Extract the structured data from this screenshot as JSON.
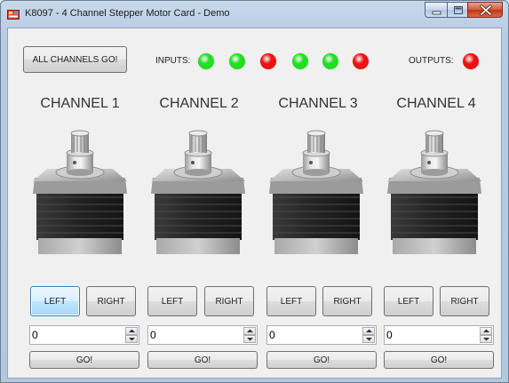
{
  "window": {
    "title": "K8097 - 4 Channel Stepper Motor Card - Demo",
    "icon": "app-board-icon",
    "controls": [
      "minimize-icon",
      "maximize-icon",
      "close-icon"
    ]
  },
  "toolbar": {
    "all_go_label": "ALL CHANNELS GO!",
    "inputs_label": "INPUTS:",
    "outputs_label": "OUTPUTS:"
  },
  "inputs": [
    {
      "state": "on",
      "color": "#22dd22"
    },
    {
      "state": "on",
      "color": "#22dd22"
    },
    {
      "state": "off",
      "color": "#ee1111"
    },
    {
      "state": "on",
      "color": "#22dd22"
    },
    {
      "state": "on",
      "color": "#22dd22"
    },
    {
      "state": "off",
      "color": "#ee1111"
    }
  ],
  "outputs": [
    {
      "state": "off",
      "color": "#ee1111"
    }
  ],
  "channels": [
    {
      "title": "CHANNEL 1",
      "left_label": "LEFT",
      "right_label": "RIGHT",
      "value": "0",
      "go_label": "GO!"
    },
    {
      "title": "CHANNEL 2",
      "left_label": "LEFT",
      "right_label": "RIGHT",
      "value": "0",
      "go_label": "GO!"
    },
    {
      "title": "CHANNEL 3",
      "left_label": "LEFT",
      "right_label": "RIGHT",
      "value": "0",
      "go_label": "GO!"
    },
    {
      "title": "CHANNEL 4",
      "left_label": "LEFT",
      "right_label": "RIGHT",
      "value": "0",
      "go_label": "GO!"
    }
  ],
  "colors": {
    "led_on": "#22dd22",
    "led_off": "#ee1111",
    "focus_border": "#3c7fb1"
  }
}
